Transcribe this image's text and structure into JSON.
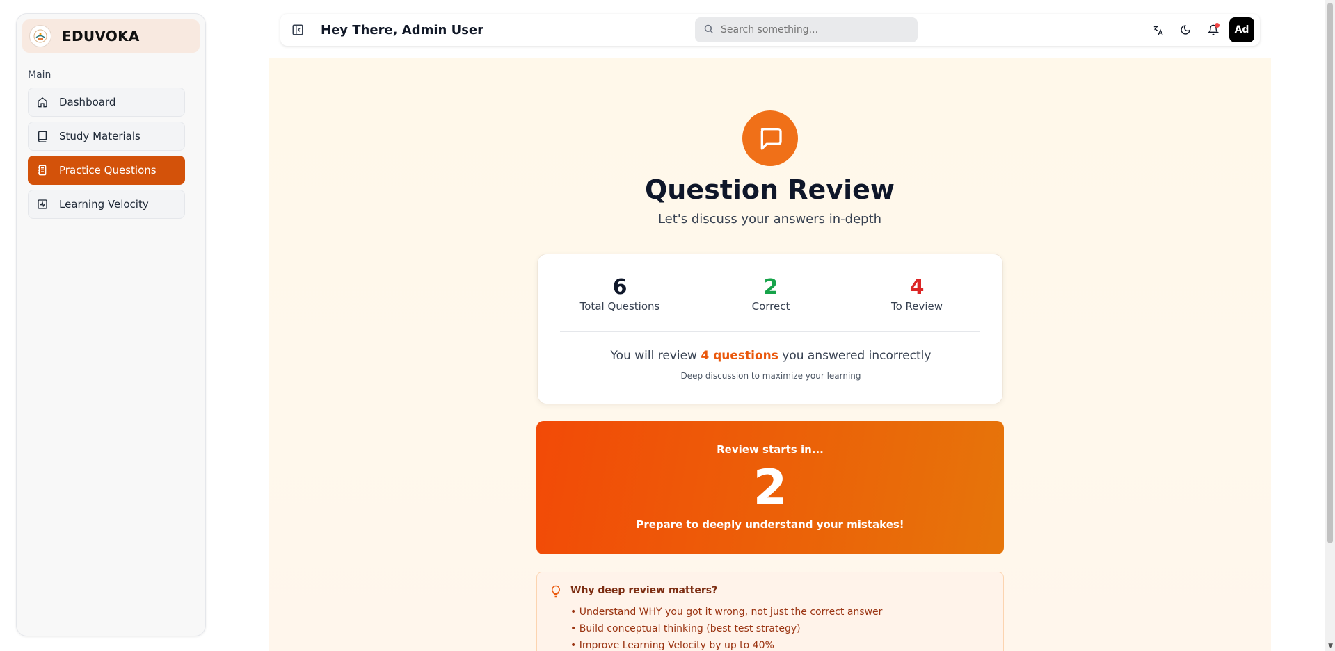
{
  "brand": {
    "name": "EDUVOKA"
  },
  "sidebar": {
    "section_label": "Main",
    "items": [
      {
        "label": "Dashboard",
        "icon": "home-icon",
        "active": false
      },
      {
        "label": "Study Materials",
        "icon": "book-icon",
        "active": false
      },
      {
        "label": "Practice Questions",
        "icon": "notebook-icon",
        "active": true
      },
      {
        "label": "Learning Velocity",
        "icon": "activity-icon",
        "active": false
      }
    ]
  },
  "header": {
    "greeting": "Hey There, Admin User",
    "search_placeholder": "Search something...",
    "avatar_initials": "Ad"
  },
  "main": {
    "title": "Question Review",
    "subtitle": "Let's discuss your answers in-depth",
    "stats": {
      "total": {
        "value": "6",
        "label": "Total Questions",
        "color": "#0f172a"
      },
      "correct": {
        "value": "2",
        "label": "Correct",
        "color": "#16a34a"
      },
      "review": {
        "value": "4",
        "label": "To Review",
        "color": "#dc2626"
      }
    },
    "review_prefix": "You will review",
    "review_highlight": "4 questions",
    "review_suffix": "you answered incorrectly",
    "review_sub": "Deep discussion to maximize your learning",
    "countdown": {
      "label": "Review starts in...",
      "value": "2",
      "message": "Prepare to deeply understand your mistakes!"
    },
    "tips": {
      "title": "Why deep review matters?",
      "items": [
        "• Understand WHY you got it wrong, not just the correct answer",
        "• Build conceptual thinking (best test strategy)",
        "• Improve Learning Velocity by up to 40%"
      ]
    }
  },
  "colors": {
    "accent": "#d3520a",
    "countdown_start": "#f24a07",
    "countdown_end": "#e6750a"
  }
}
